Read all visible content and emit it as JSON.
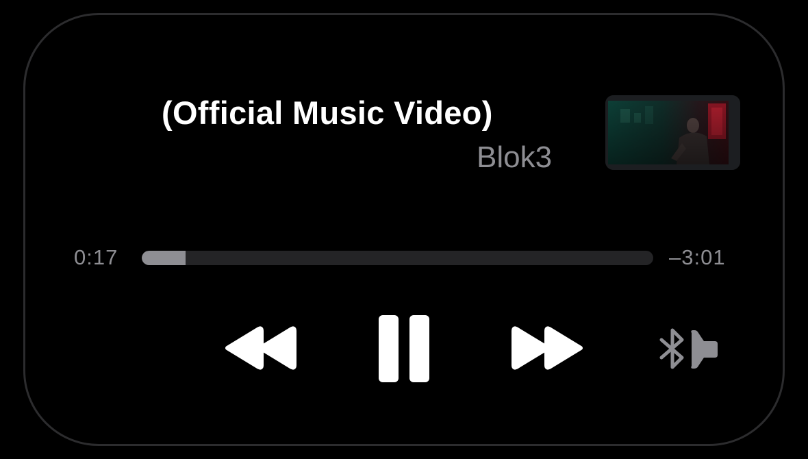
{
  "now_playing": {
    "title": "(Official Music Video)",
    "artist": "Blok3",
    "artwork_icon": "video-thumbnail"
  },
  "progress": {
    "elapsed": "0:17",
    "remaining": "–3:01",
    "fraction": 0.086
  },
  "controls": {
    "rewind_icon": "rewind-icon",
    "pause_icon": "pause-icon",
    "forward_icon": "fast-forward-icon",
    "audio_route_icon": "bluetooth-speaker-icon"
  },
  "colors": {
    "primary_text": "#ffffff",
    "secondary_text": "#8e8e93",
    "track": "#242426",
    "fill": "#8e8e93",
    "border": "#2c2c2e"
  }
}
